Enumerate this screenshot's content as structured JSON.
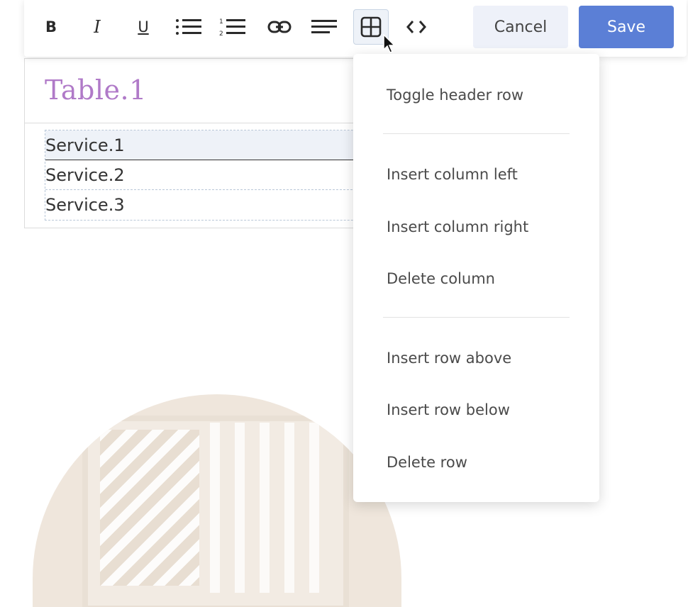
{
  "toolbar": {
    "tools": [
      {
        "name": "bold-button",
        "glyph": "B"
      },
      {
        "name": "italic-button",
        "glyph": "I"
      },
      {
        "name": "underline-button",
        "glyph": "U"
      },
      {
        "name": "bullet-list-button",
        "icon": "bullet-list-icon"
      },
      {
        "name": "numbered-list-button",
        "icon": "numbered-list-icon"
      },
      {
        "name": "link-button",
        "icon": "link-icon"
      },
      {
        "name": "align-button",
        "icon": "align-left-icon"
      },
      {
        "name": "table-button",
        "icon": "table-icon",
        "active": true
      },
      {
        "name": "code-button",
        "icon": "code-icon"
      }
    ],
    "cancel_label": "Cancel",
    "save_label": "Save"
  },
  "editor": {
    "title": "Table.1",
    "rows": [
      "Service.1",
      "Service.2",
      "Service.3"
    ]
  },
  "table_menu": {
    "items": [
      "Toggle header row",
      "Insert column left",
      "Insert column right",
      "Delete column",
      "Insert row above",
      "Insert row below",
      "Delete row"
    ]
  },
  "colors": {
    "accent": "#5b7fd6",
    "title": "#b07ac8",
    "cancel_bg": "#eef1f9"
  }
}
